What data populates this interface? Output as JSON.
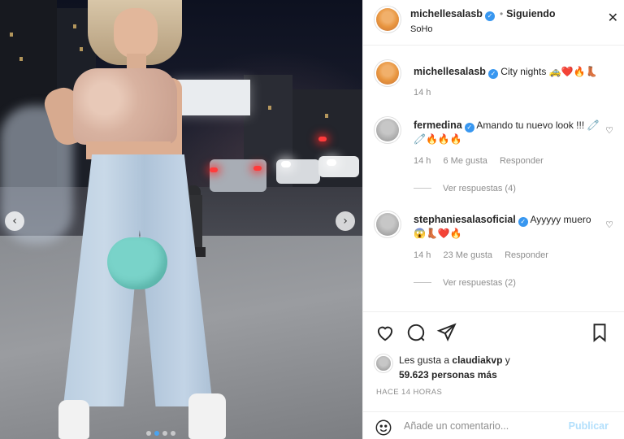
{
  "post": {
    "username": "michellesalasb",
    "following_label": "Siguiendo",
    "location": "SoHo",
    "caption": "City nights 🚕❤️🔥👢",
    "caption_time": "14 h"
  },
  "comments": [
    {
      "username": "fermedina",
      "text": "Amando tu nuevo look !!! 🧷🧷🔥🔥🔥",
      "time": "14 h",
      "likes": "6 Me gusta",
      "reply_label": "Responder",
      "view_replies": "Ver respuestas (4)"
    },
    {
      "username": "stephaniesalasoficial",
      "text": "Ayyyyy muero😱👢❤️🔥",
      "time": "14 h",
      "likes": "23 Me gusta",
      "reply_label": "Responder",
      "view_replies": "Ver respuestas (2)"
    }
  ],
  "likes": {
    "prefix": "Les gusta a",
    "first_user": "claudiakvp",
    "connector": "y",
    "others": "59.623 personas más"
  },
  "time_ago": "HACE 14 HORAS",
  "add_comment": {
    "placeholder": "Añade un comentario...",
    "publish_label": "Publicar"
  },
  "icons": {
    "close": "close-icon",
    "heart": "heart-icon",
    "comment": "comment-icon",
    "share": "paper-plane-icon",
    "save": "bookmark-icon",
    "emoji": "smiley-icon",
    "verified": "verified-badge-icon",
    "prev": "chevron-left-icon",
    "next": "chevron-right-icon"
  },
  "colors": {
    "verified_blue": "#3897f0",
    "publish_disabled": "#b2dffc",
    "meta_gray": "#8e8e8e",
    "text": "#262626"
  }
}
